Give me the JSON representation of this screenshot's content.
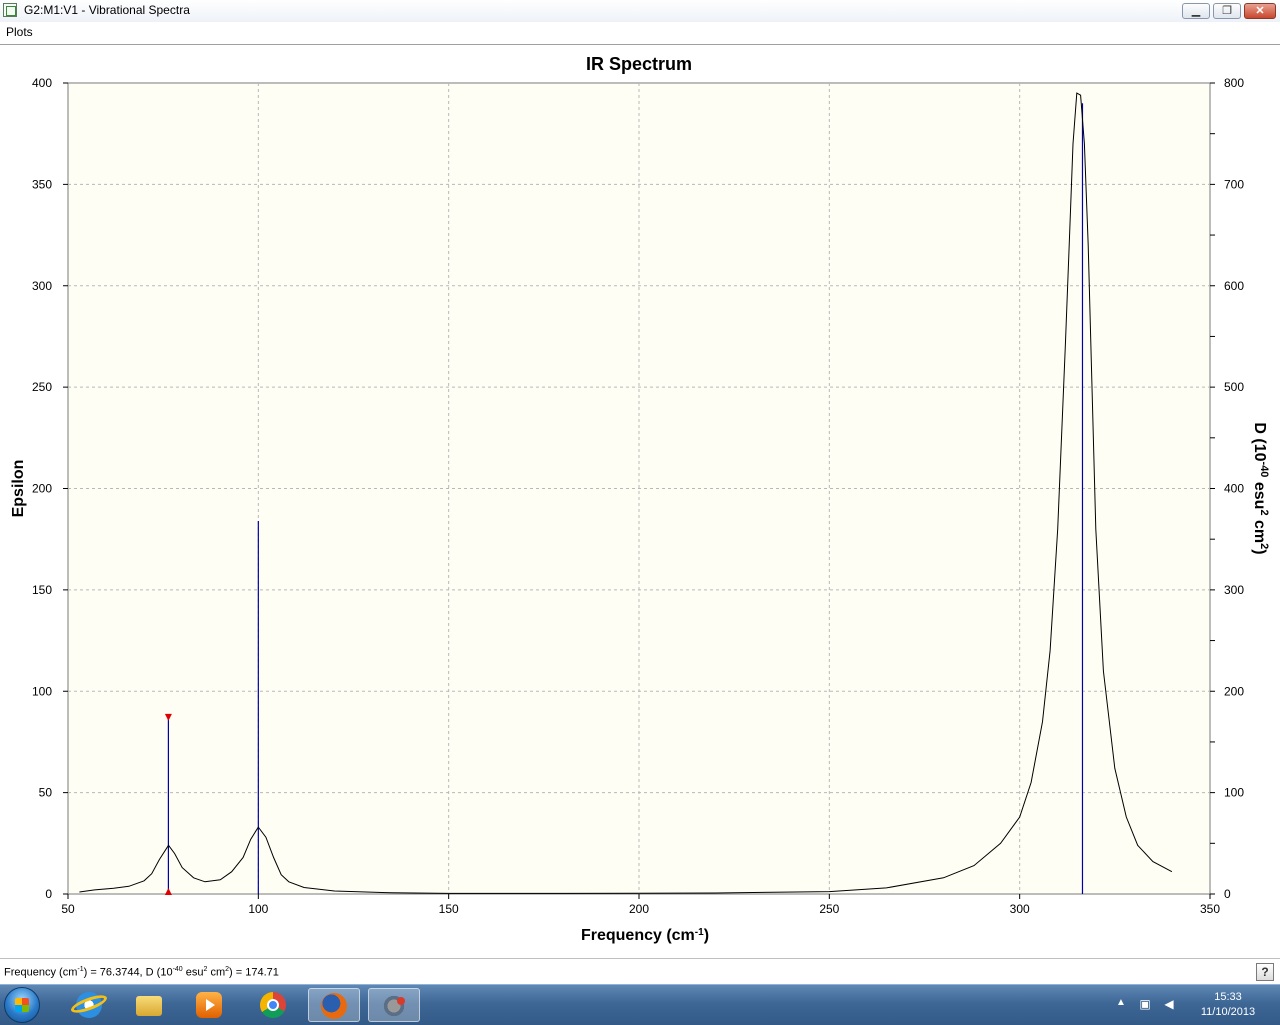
{
  "window": {
    "title": "G2:M1:V1 - Vibrational Spectra",
    "minimize_glyph": "▁",
    "maximize_glyph": "❐",
    "close_glyph": "✕"
  },
  "menu": {
    "items": [
      {
        "label": "Plots"
      }
    ]
  },
  "chart_data": {
    "type": "line",
    "title": "IR Spectrum",
    "xlabel": "Frequency (cm-1)",
    "xlabel_parts": {
      "text": "Frequency (cm",
      "sup": "-1",
      "suffix": ")"
    },
    "ylabel": "Epsilon",
    "y2label": "D (10-40 esu2 cm2)",
    "y2label_parts": [
      {
        "text": "D (10"
      },
      {
        "sup": "-40"
      },
      {
        "text": " esu"
      },
      {
        "sup": "2"
      },
      {
        "text": " cm"
      },
      {
        "sup": "2"
      },
      {
        "text": ")"
      }
    ],
    "xlim": [
      50,
      350
    ],
    "ylim": [
      0,
      400
    ],
    "y2lim": [
      0,
      800
    ],
    "xticks": [
      50,
      100,
      150,
      200,
      250,
      300,
      350
    ],
    "yticks": [
      0,
      50,
      100,
      150,
      200,
      250,
      300,
      350,
      400
    ],
    "y2ticks": [
      0,
      100,
      200,
      300,
      400,
      500,
      600,
      700,
      800
    ],
    "grid": true,
    "background": "#fffef5",
    "spectrum": {
      "name": "Epsilon",
      "color": "#000000",
      "x": [
        53,
        57,
        62,
        66,
        70,
        72,
        74,
        76.4,
        78,
        80,
        83,
        86,
        90,
        93,
        96,
        98,
        100,
        102,
        104,
        106,
        108,
        112,
        120,
        135,
        150,
        180,
        220,
        250,
        265,
        280,
        288,
        295,
        300,
        303,
        306,
        308,
        310,
        312,
        313,
        314,
        315,
        316,
        317,
        318,
        319,
        320,
        322,
        325,
        328,
        331,
        335,
        340
      ],
      "y": [
        1,
        2,
        2.8,
        3.8,
        6.5,
        10,
        17,
        24,
        20,
        13,
        8,
        6,
        7,
        11,
        18,
        27,
        33,
        28,
        18,
        9.5,
        6,
        3.2,
        1.5,
        0.6,
        0.3,
        0.3,
        0.5,
        1.2,
        3,
        8,
        14,
        25,
        38,
        55,
        85,
        120,
        180,
        270,
        320,
        370,
        395,
        394,
        370,
        320,
        250,
        180,
        110,
        62,
        38,
        24,
        16,
        11
      ]
    },
    "sticks": {
      "name": "D",
      "color": "#0000aa",
      "x": [
        76.3744,
        100,
        316.5
      ],
      "d": [
        174.71,
        368,
        780
      ]
    },
    "selected_stick": {
      "x": 76.3744,
      "d": 174.71,
      "marker_color": "#e00000"
    }
  },
  "status": {
    "parts": [
      {
        "text": "Frequency (cm"
      },
      {
        "sup": "-1"
      },
      {
        "text": ") = 76.3744, D (10"
      },
      {
        "sup": "-40"
      },
      {
        "text": " esu"
      },
      {
        "sup": "2"
      },
      {
        "text": " cm"
      },
      {
        "sup": "2"
      },
      {
        "text": ") = 174.71"
      }
    ],
    "help_label": "?"
  },
  "taskbar": {
    "apps": [
      {
        "name": "internet-explorer"
      },
      {
        "name": "file-explorer"
      },
      {
        "name": "media-player"
      },
      {
        "name": "chrome"
      },
      {
        "name": "firefox"
      },
      {
        "name": "gaussview"
      }
    ],
    "clock_time": "15:33",
    "clock_date": "11/10/2013"
  }
}
